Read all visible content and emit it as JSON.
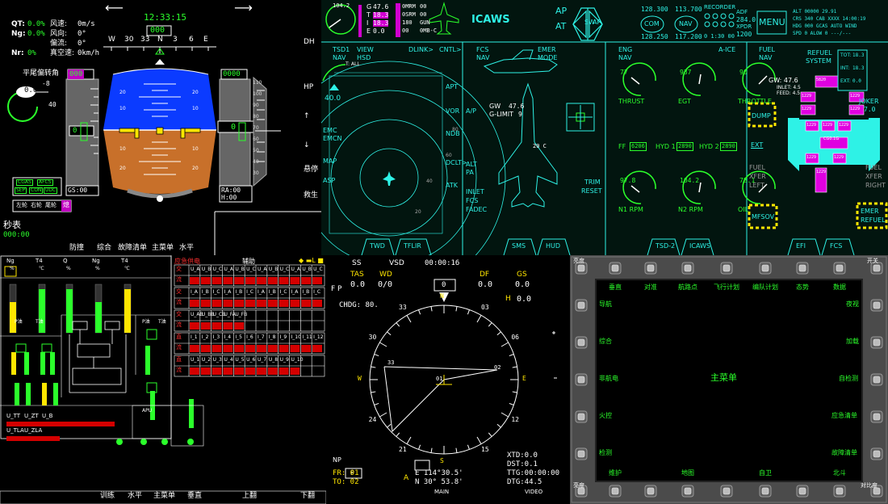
{
  "p1": {
    "hud_labels": [
      {
        "k": "QT:",
        "v": "0.0%"
      },
      {
        "k": "Ng:",
        "v": "0.0%"
      },
      {
        "k": "",
        "v": ""
      },
      {
        "k": "Nr:",
        "v": "0%"
      }
    ],
    "wind": [
      {
        "k": "风速:",
        "v": "0m/s"
      },
      {
        "k": "风向:",
        "v": "0°"
      },
      {
        "k": "偏流:",
        "v": "0°"
      },
      {
        "k": "真空速:",
        "v": "0km/h"
      }
    ],
    "clock": "12:33:15",
    "heading_box": "000",
    "heading_scale": [
      "W",
      "30",
      "33",
      "N",
      "3",
      "6",
      "E"
    ],
    "tail_angle_label": "平尾偏转角",
    "tail_angle_value": "0.0",
    "tail_ticks": [
      "-8",
      "40"
    ],
    "speed_box": "000",
    "speed_value": "0",
    "alt_box": "0000",
    "alt_value": "0",
    "alt_scale": [
      "110",
      "100",
      "90",
      "80",
      "70",
      "60",
      "50",
      "40",
      "30"
    ],
    "pitch_marks": [
      "20",
      "10",
      "10",
      "20"
    ],
    "status_boxes": [
      "CGAS",
      "AFCS",
      "SEP",
      "CON",
      "UDC"
    ],
    "gs_label": "GS:00",
    "ra_label": "RA:00",
    "h_label": "H:00",
    "bottom_row": [
      "左轮",
      "右轮",
      "尾轮"
    ],
    "bottom_right": "熄",
    "timer_label": "秒表",
    "timer_value": "000:00",
    "soft_keys": [
      "防撞",
      "综合",
      "故障清单",
      "主菜单",
      "水平"
    ],
    "side_keys": [
      "DH",
      "HP",
      "↑",
      "↓",
      "悬停",
      "救生"
    ]
  },
  "p2": {
    "top": {
      "gauge_val": "104.2",
      "stores": [
        {
          "k": "G",
          "v": "47.6"
        },
        {
          "k": "T",
          "v": "18.3"
        },
        {
          "k": "I",
          "v": "18.3"
        },
        {
          "k": "E",
          "v": "0.0"
        }
      ],
      "weapons": [
        {
          "k": "0MRM",
          "v": "00"
        },
        {
          "k": "0SRM",
          "v": "00"
        },
        {
          "k": "180",
          "v": "GUN"
        },
        {
          "k": "00",
          "v": "0MB-C"
        }
      ],
      "icaws": "ICAWS",
      "ap": "AP",
      "at": "AT",
      "sw": "SW",
      "ap2": "AP",
      "com_top": "128.300",
      "com_label": "COM",
      "com_bot": "128.250",
      "nav_top": "113.700",
      "nav_label": "NAV",
      "nav_bot": "117.200",
      "recorder": "RECORDER",
      "rec_time": "0 1:30 00",
      "adf": "ADF",
      "adf_val": "284.0",
      "xpdr": "XPDR",
      "xpdr_val": "1200",
      "menu": "MENU",
      "alt_info": [
        "ALT 00000  29.91",
        "CRS 340  CAB  XXXX  14:00:19",
        "HDG 000  GCAS AUTO  WIND",
        "SPD   0  ALOW    0     ---/---"
      ]
    },
    "tsd": {
      "tsd1": "TSD1",
      "nav": "NAV",
      "view": "VIEW",
      "hsd": "HSD",
      "tall": "T: ALL",
      "dlink": "DLINK>",
      "cntl": "CNTL>",
      "right_items": [
        "APT",
        "VOR",
        "NDB",
        "DCLT>",
        "ATK"
      ],
      "left_items": [
        "EMC",
        "EMCN",
        "MAP",
        "ASP"
      ],
      "range_val": "40.0",
      "rings": [
        "20",
        "40",
        "60",
        "80"
      ],
      "tabs": [
        "TWD",
        "TFLIR"
      ]
    },
    "fcs": {
      "fcs": "FCS",
      "nav": "NAV",
      "emer": "EMER",
      "mode": "MODE",
      "gw": "GW",
      "gw_val": "47.6",
      "glimit": "G-LIMIT",
      "gl_val": "9",
      "ap": "A/P",
      "alt": "ALT",
      "pa": "PA",
      "inlet": "INLET",
      "fcs2": "FCS",
      "fadec": "FADEC",
      "temp": "20 C",
      "trim": "TRIM",
      "reset": "RESET",
      "tabs": [
        "SMS",
        "HUD"
      ]
    },
    "eng": {
      "eng": "ENG",
      "nav": "NAV",
      "aice": "A-ICE",
      "gauges": [
        {
          "name": "THRUST",
          "val": "77"
        },
        {
          "name": "EGT",
          "val": "937"
        },
        {
          "name": "THROTTLE",
          "val": "90"
        },
        {
          "name": "N1 RPM",
          "val": "97.8"
        },
        {
          "name": "N2 RPM",
          "val": "104.2"
        },
        {
          "name": "OIL",
          "val": "78.1"
        }
      ],
      "ff_label": "FF",
      "ff": "6206",
      "hyd1_label": "HYD 1",
      "hyd1": "2890",
      "hyd2_label": "HYD 2",
      "hyd2": "2890",
      "tabs": [
        "TSD-2",
        "ICAWS"
      ]
    },
    "fuel": {
      "fuel": "FUEL",
      "nav": "NAV",
      "refuel": "REFUEL",
      "system": "SYSTEM",
      "gw": "GW: 47.6",
      "inlet": "INLET: 4.5",
      "feed": "FEED: 4.5",
      "tot_label": "TOT:",
      "tot": "18.3",
      "int_label": "INT:",
      "int": "18.3",
      "ext_label": "EXT:",
      "ext": "0.0",
      "joker": "JOKER",
      "joker_val": "7.0",
      "bingo": "BINGO",
      "bingo_val": "2.0",
      "dump": "DUMP",
      "ext_btn": "EXT",
      "fuel_xfer_left": [
        "FUEL",
        "XFER",
        "LEFT"
      ],
      "fuel_xfer_right": [
        "FUEL",
        "XFER",
        "RIGHT"
      ],
      "mfsov": "MFSOV",
      "emer_refuel": [
        "EMER",
        "REFUEL"
      ],
      "cg": "CG0.1G",
      "tanks": [
        "5820",
        "1229",
        "1229",
        "1229",
        "1229",
        "1229",
        "1229",
        "1229",
        "1229",
        "1229",
        "1229",
        "1229"
      ],
      "tabs": [
        "EFI",
        "FCS"
      ]
    }
  },
  "p3": {
    "gauges": [
      {
        "label": "Ng",
        "unit": "%"
      },
      {
        "label": "T4",
        "unit": "℃"
      },
      {
        "label": "Q",
        "unit": "%"
      },
      {
        "label": "Ng",
        "unit": "%"
      },
      {
        "label": "T4",
        "unit": "℃"
      }
    ],
    "mid_labels": [
      "P油",
      "T油",
      "P油",
      "T油"
    ],
    "title_emergency": "应急供电",
    "title_aux": "辅助",
    "rows": [
      {
        "head": [
          "交",
          "流"
        ],
        "cells": [
          "U_A",
          "U_B",
          "U_C",
          "U_A",
          "U_B",
          "U_C",
          "U_A",
          "U_B",
          "U_C",
          "U_A",
          "U_B",
          "U_C"
        ]
      },
      {
        "head": [
          "交",
          "流"
        ],
        "cells": [
          "I_A",
          "I_B",
          "I_C",
          "I_A",
          "I_B",
          "I_C",
          "I_A",
          "I_B",
          "I_C",
          "I_A",
          "I_B",
          "I_C"
        ]
      },
      {
        "head": [
          "交",
          "流"
        ],
        "cells": [
          "U_AB",
          "U_BB",
          "U_CB",
          "U_FA",
          "U_FB",
          "",
          "",
          "",
          "",
          "",
          "",
          ""
        ]
      },
      {
        "head": [
          "直",
          "流"
        ],
        "cells": [
          "I_1",
          "I_2",
          "I_3",
          "I_4",
          "I_5",
          "I_6",
          "I_7",
          "I_8",
          "I_9",
          "I_10",
          "I_11",
          "I_12"
        ]
      },
      {
        "head": [
          "直",
          "流"
        ],
        "cells": [
          "U_1",
          "U_2",
          "U_3",
          "U_4",
          "U_5",
          "U_6",
          "U_7",
          "U_8",
          "U_9",
          "U_10",
          "",
          ""
        ]
      }
    ],
    "apu": "APU",
    "bottom_vals": [
      {
        "k": "U_TT",
        "v": ""
      },
      {
        "k": "U_ZT",
        "v": ""
      },
      {
        "k": "U_B",
        "v": ""
      },
      {
        "k": "U_TLA",
        "v": ""
      },
      {
        "k": "U_ZLA",
        "v": ""
      }
    ],
    "soft_keys": [
      "训练",
      "水平",
      "主菜单",
      "垂直",
      "上翻",
      "下翻"
    ]
  },
  "p4": {
    "ss": "SS",
    "vsd": "VSD",
    "time": "00:00:16",
    "tas": "TAS",
    "tas_val": "0.0",
    "wd": "WD",
    "wd_val": "0/0",
    "df": "DF",
    "df_val": "0.0",
    "gs": "GS",
    "gs_val": "0.0",
    "fp": "F P",
    "h": "H",
    "h_val": "0.0",
    "chdg": "CHDG: 80.",
    "hdg_box": "0",
    "compass": [
      "N",
      "03",
      "06",
      "E",
      "12",
      "15",
      "S",
      "21",
      "24",
      "W",
      "30",
      "33"
    ],
    "np": "NP",
    "np_box": "P",
    "fr": "FR:  01",
    "to": "TO:  02",
    "pos1": "E  114°30.5'",
    "pos2": "N  30° 53.8'",
    "xtd": "XTD:0.0",
    "dst": "DST:0.1",
    "ttg": "TTG:00:00:00",
    "dtg": "DTG:44.5",
    "a": "A",
    "main": "MAIN",
    "video": "VIDEO",
    "wp1": "01",
    "wp2": "02",
    "wp3": "33"
  },
  "p5": {
    "corner_tl": "亮度",
    "corner_tr": "开关",
    "corner_bl": "亮度",
    "corner_br": "对比度",
    "top_labels": [
      "垂直",
      "对准",
      "航路点",
      "飞行计划",
      "编队计划",
      "态势",
      "数据"
    ],
    "left_labels": [
      "导航",
      "综合",
      "非航电",
      "火控",
      "检测"
    ],
    "right_labels": [
      "夜视",
      "加载",
      "自检测",
      "应急清单",
      "故障清单"
    ],
    "bottom_labels": [
      "维护",
      "地图",
      "自卫",
      "北斗"
    ],
    "center": "主菜单",
    "tl_top": "亮度"
  }
}
